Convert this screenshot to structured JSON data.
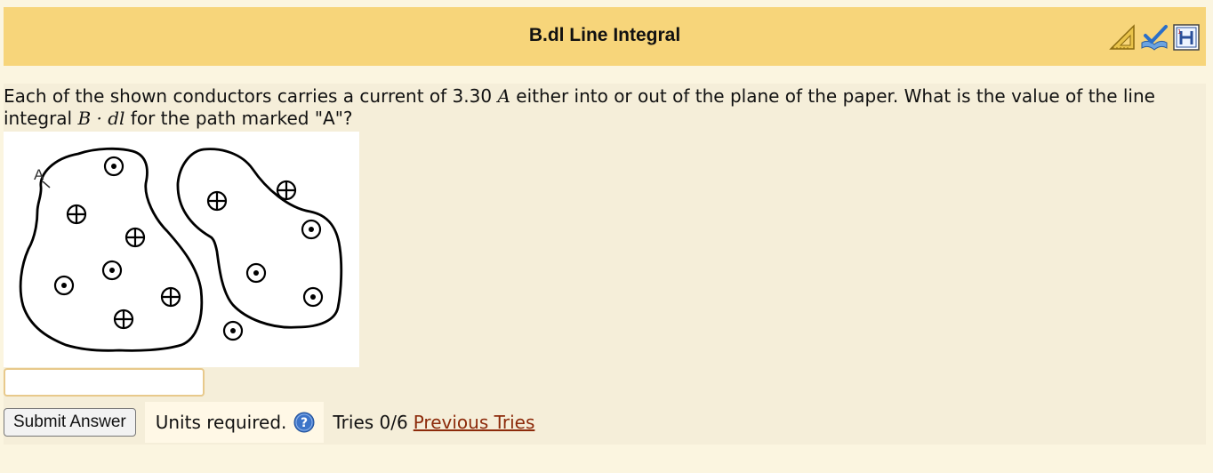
{
  "header": {
    "title": "B.dl Line Integral"
  },
  "question": {
    "part1": "Each of the shown conductors carries a current of 3.30 ",
    "unit_symbol": "A",
    "part2": " either into or out of the plane of the paper. What is the value of the line integral ",
    "integrand": "B · dl",
    "part3": " for the path marked \"A\"?"
  },
  "figure": {
    "path_label": "A"
  },
  "answer": {
    "value": ""
  },
  "controls": {
    "submit_label": "Submit Answer",
    "units_text": "Units required.",
    "tries_text": "Tries 0/6",
    "previous_tries_label": "Previous Tries"
  },
  "colors": {
    "header_bg": "#f7d57a",
    "page_bg": "#fbf5e0",
    "panel_bg": "#f5eed9",
    "link": "#8c2a0a"
  }
}
